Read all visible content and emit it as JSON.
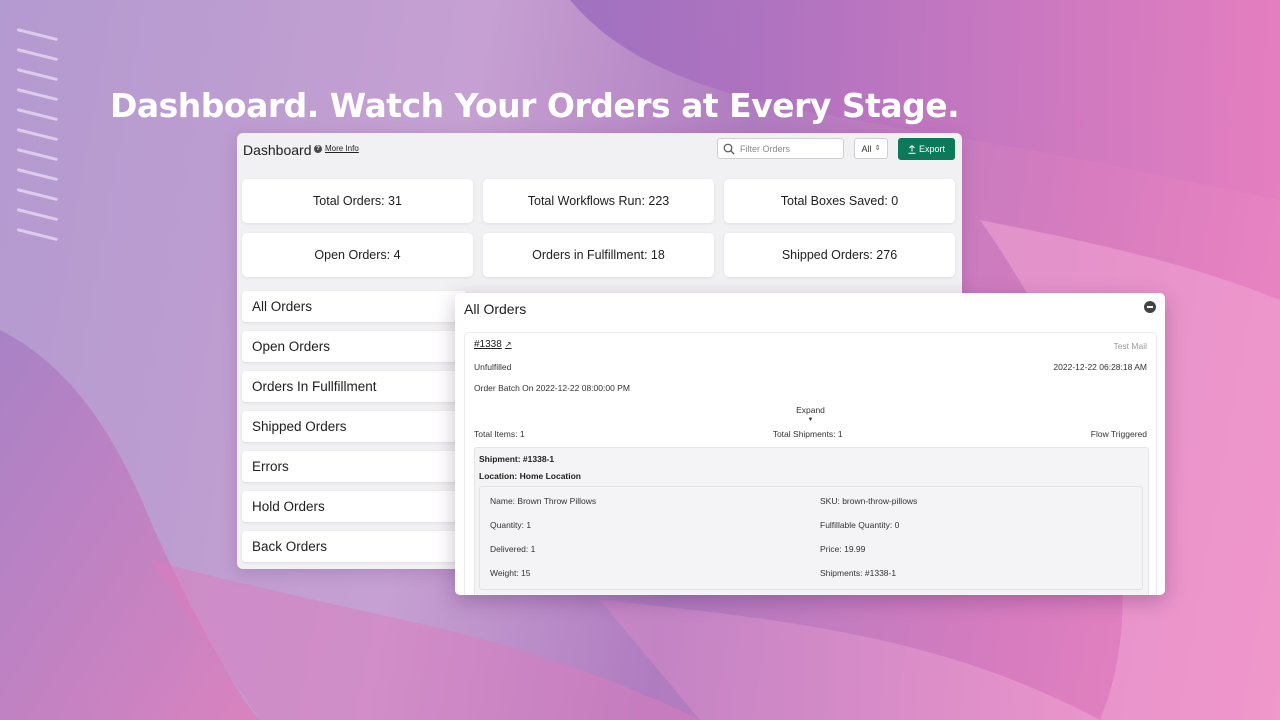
{
  "headline": "Dashboard. Watch Your Orders at Every Stage.",
  "colors": {
    "export_button": "#0c7a5a",
    "background_start": "#b39ad0",
    "background_end": "#ef86c2"
  },
  "dashboard": {
    "title": "Dashboard",
    "more_info_icon": "question-circle-icon",
    "more_info_label": "More Info",
    "search": {
      "icon": "search-icon",
      "placeholder": "Filter Orders",
      "value": ""
    },
    "filter_select": {
      "value": "All",
      "icon": "updown-arrows-icon"
    },
    "export_button": {
      "label": "Export",
      "icon": "upload-icon"
    },
    "stats": [
      {
        "label": "Total Orders: 31"
      },
      {
        "label": "Total Workflows Run: 223"
      },
      {
        "label": "Total Boxes Saved: 0"
      },
      {
        "label": "Open Orders: 4"
      },
      {
        "label": "Orders in Fulfillment: 18"
      },
      {
        "label": "Shipped Orders: 276"
      }
    ],
    "nav": [
      {
        "label": "All Orders"
      },
      {
        "label": "Open Orders"
      },
      {
        "label": "Orders In Fullfillment"
      },
      {
        "label": "Shipped Orders"
      },
      {
        "label": "Errors"
      },
      {
        "label": "Hold Orders"
      },
      {
        "label": "Back Orders"
      }
    ]
  },
  "modal": {
    "title": "All Orders",
    "close_icon": "minus-circle-icon",
    "order": {
      "number": "#1338",
      "external_icon": "external-link-icon",
      "tag": "Test Mail",
      "status": "Unfulfilled",
      "created_at": "2022-12-22 06:28:18 AM",
      "batch": "Order Batch On 2022-12-22 08:00:00 PM",
      "expand_label": "Expand",
      "expand_icon": "caret-down-icon",
      "total_items": "Total Items:  1",
      "total_shipments": "Total Shipments:  1",
      "flow_status": "Flow Triggered",
      "shipment": {
        "id": "Shipment: #1338-1",
        "location": "Location: Home Location",
        "fields": [
          "Name:  Brown Throw Pillows",
          "SKU:  brown-throw-pillows",
          "Quantity:  1",
          "Fulfillable Quantity:  0",
          "Delivered:  1",
          "Price:  19.99",
          "Weight:  15",
          "Shipments:  #1338-1"
        ]
      }
    }
  }
}
